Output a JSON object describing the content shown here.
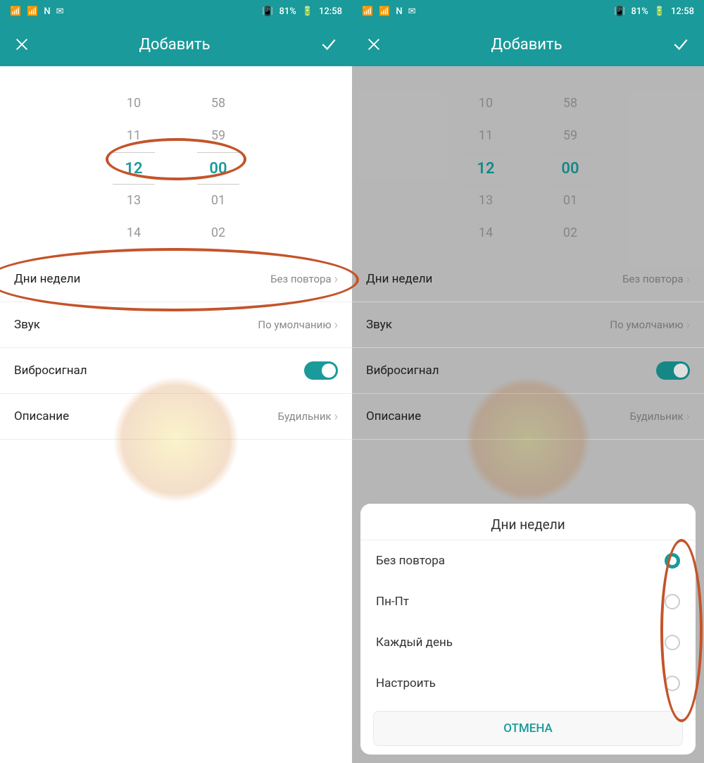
{
  "status": {
    "battery": "81%",
    "time": "12:58",
    "nfc": "N",
    "mail": "✉"
  },
  "header": {
    "title": "Добавить"
  },
  "timePicker": {
    "hours": [
      "10",
      "11",
      "12",
      "13",
      "14"
    ],
    "minutes": [
      "58",
      "59",
      "00",
      "01",
      "02"
    ],
    "selectedHour": "12",
    "selectedMinute": "00"
  },
  "settings": {
    "days": {
      "label": "Дни недели",
      "value": "Без повтора"
    },
    "sound": {
      "label": "Звук",
      "value": "По умолчанию"
    },
    "vibrate": {
      "label": "Вибросигнал"
    },
    "description": {
      "label": "Описание",
      "value": "Будильник"
    }
  },
  "sheet": {
    "title": "Дни недели",
    "options": [
      {
        "label": "Без повтора",
        "checked": true
      },
      {
        "label": "Пн-Пт",
        "checked": false
      },
      {
        "label": "Каждый день",
        "checked": false
      },
      {
        "label": "Настроить",
        "checked": false
      }
    ],
    "cancel": "ОТМЕНА"
  }
}
